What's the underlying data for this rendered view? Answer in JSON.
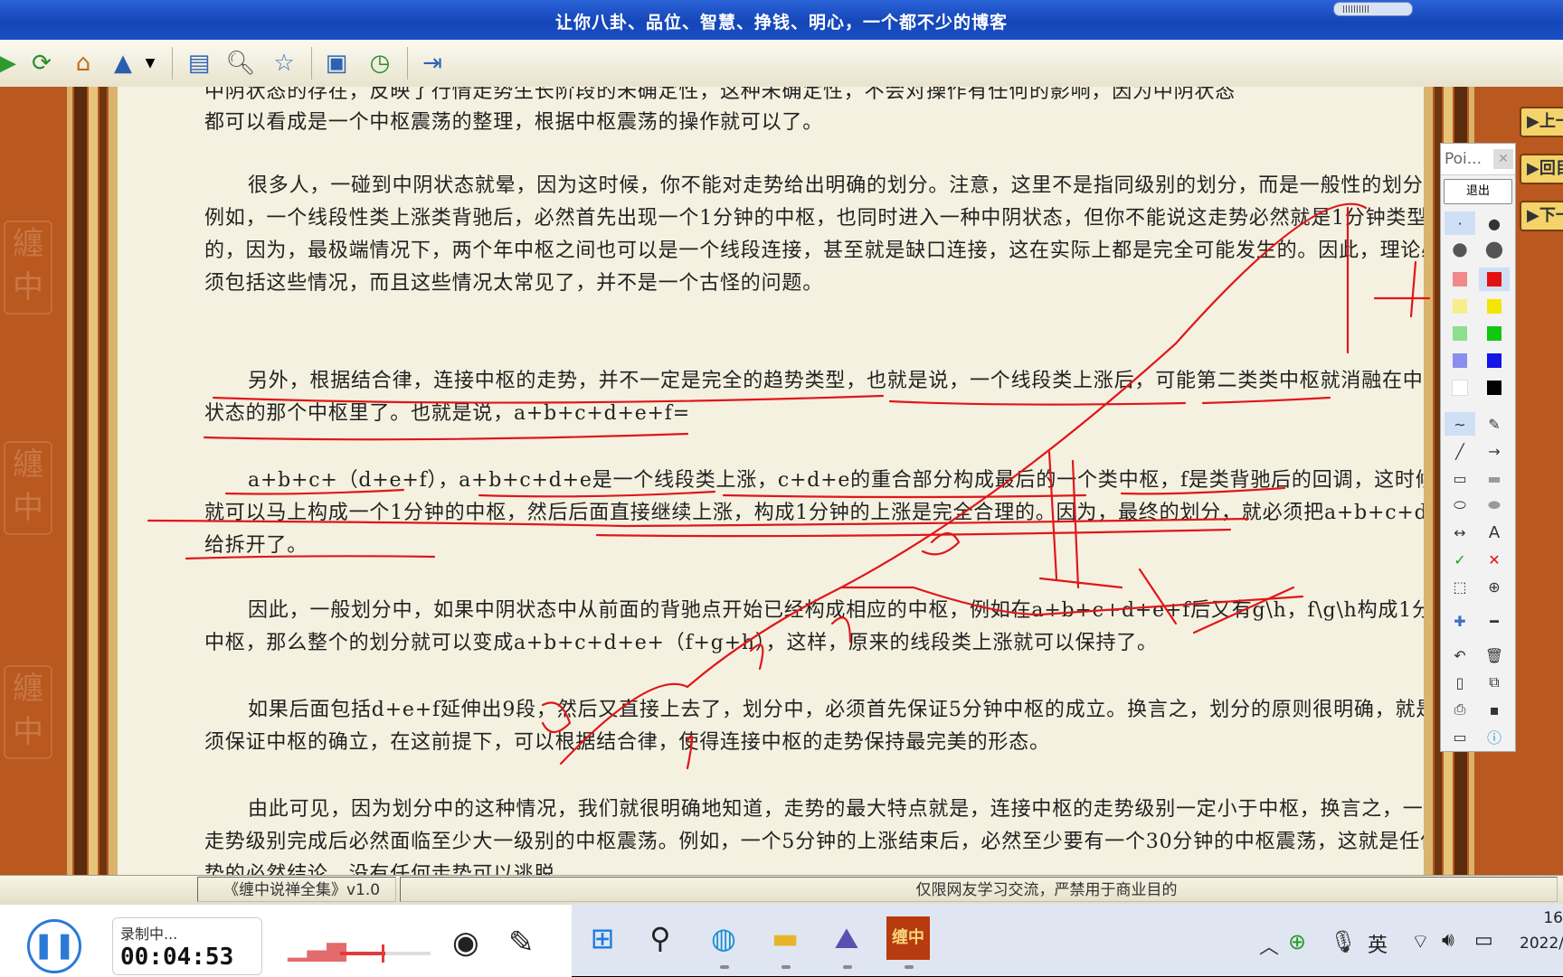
{
  "window": {
    "title": "让你八卦、品位、智慧、挣钱、明心，一个都不少的博客"
  },
  "toolbar": {
    "icons": [
      "forward-icon",
      "refresh-icon",
      "home-icon",
      "tree-icon",
      "dropdown-icon",
      "panel-icon",
      "search-icon",
      "favorite-icon",
      "window-icon",
      "history-icon",
      "exit-icon"
    ]
  },
  "frame": {
    "seal_text": "纏中"
  },
  "article": {
    "p0": "中阴状态的存在，反映了行情走势生长阶段的未确定性，这种未确定性，不会对操作有任何的影响，因为中阴状态",
    "p0b": "都可以看成是一个中枢震荡的整理，根据中枢震荡的操作就可以了。",
    "p1": "很多人，一碰到中阴状态就晕，因为这时候，你不能对走势给出明确的划分。注意，这里不是指同级别的划分，而是一般性的划分。例如，一个线段性类上涨类背驰后，必然首先出现一个1分钟的中枢，也同时进入一种中阴状态，但你不能说这走势必然就是1分钟类型的，因为，最极端情况下，两个年中枢之间也可以是一个线段连接，甚至就是缺口连接，这在实际上都是完全可能发生的。因此，理论必须包括这些情况，而且这些情况太常见了，并不是一个古怪的问题。",
    "p2": "另外，根据结合律，连接中枢的走势，并不一定是完全的趋势类型，也就是说，一个线段类上涨后，可能第二类类中枢就消融在中阴状态的那个中枢里了。也就是说，a+b+c+d+e+f=",
    "p3": "a+b+c+（d+e+f），a+b+c+d+e是一个线段类上涨，c+d+e的重合部分构成最后的一个类中枢，f是类背驰后的回调，这时候，就可以马上构成一个1分钟的中枢，然后后面直接继续上涨，构成1分钟的上涨是完全合理的。因为，最终的划分，就必须把a+b+c+d+e给拆开了。",
    "p4": "因此，一般划分中，如果中阴状态中从前面的背驰点开始已经构成相应的中枢，例如在a+b+c+d+e+f后又有g\\h，f\\g\\h构成1分钟中枢，那么整个的划分就可以变成a+b+c+d+e+（f+g+h），这样，原来的线段类上涨就可以保持了。",
    "p5": "如果后面包括d+e+f延伸出9段，然后又直接上去了，划分中，必须首先保证5分钟中枢的成立。换言之，划分的原则很明确，就是必须保证中枢的确立，在这前提下，可以根据结合律，使得连接中枢的走势保持最完美的形态。",
    "p6": "由此可见，因为划分中的这种情况，我们就很明确地知道，走势的最大特点就是，连接中枢的走势级别一定小于中枢，换言之，一个走势级别完成后必然面临至少大一级别的中枢震荡。例如，一个5分钟的上涨结束后，必然至少要有一个30分钟的中枢震荡，这就是任何走势的必然结论，没有任何走势可以逃脱。"
  },
  "nav": {
    "prev": "▶上一",
    "back": "▶回目",
    "next": "▶下一"
  },
  "palette": {
    "title": "Poi...",
    "exit_label": "退出"
  },
  "statusbar": {
    "book": "《缠中说禅全集》v1.0",
    "notice": "仅限网友学习交流，严禁用于商业目的"
  },
  "recorder": {
    "status": "录制中...",
    "time": "00:04:53"
  },
  "taskbar": {
    "ime": "英",
    "clock_time": "16",
    "clock_date": "2022/"
  },
  "colors": {
    "title": "#1d4fc4",
    "frame": "#b9581f",
    "page": "#f5f1e0",
    "ink": "#e0161b"
  }
}
